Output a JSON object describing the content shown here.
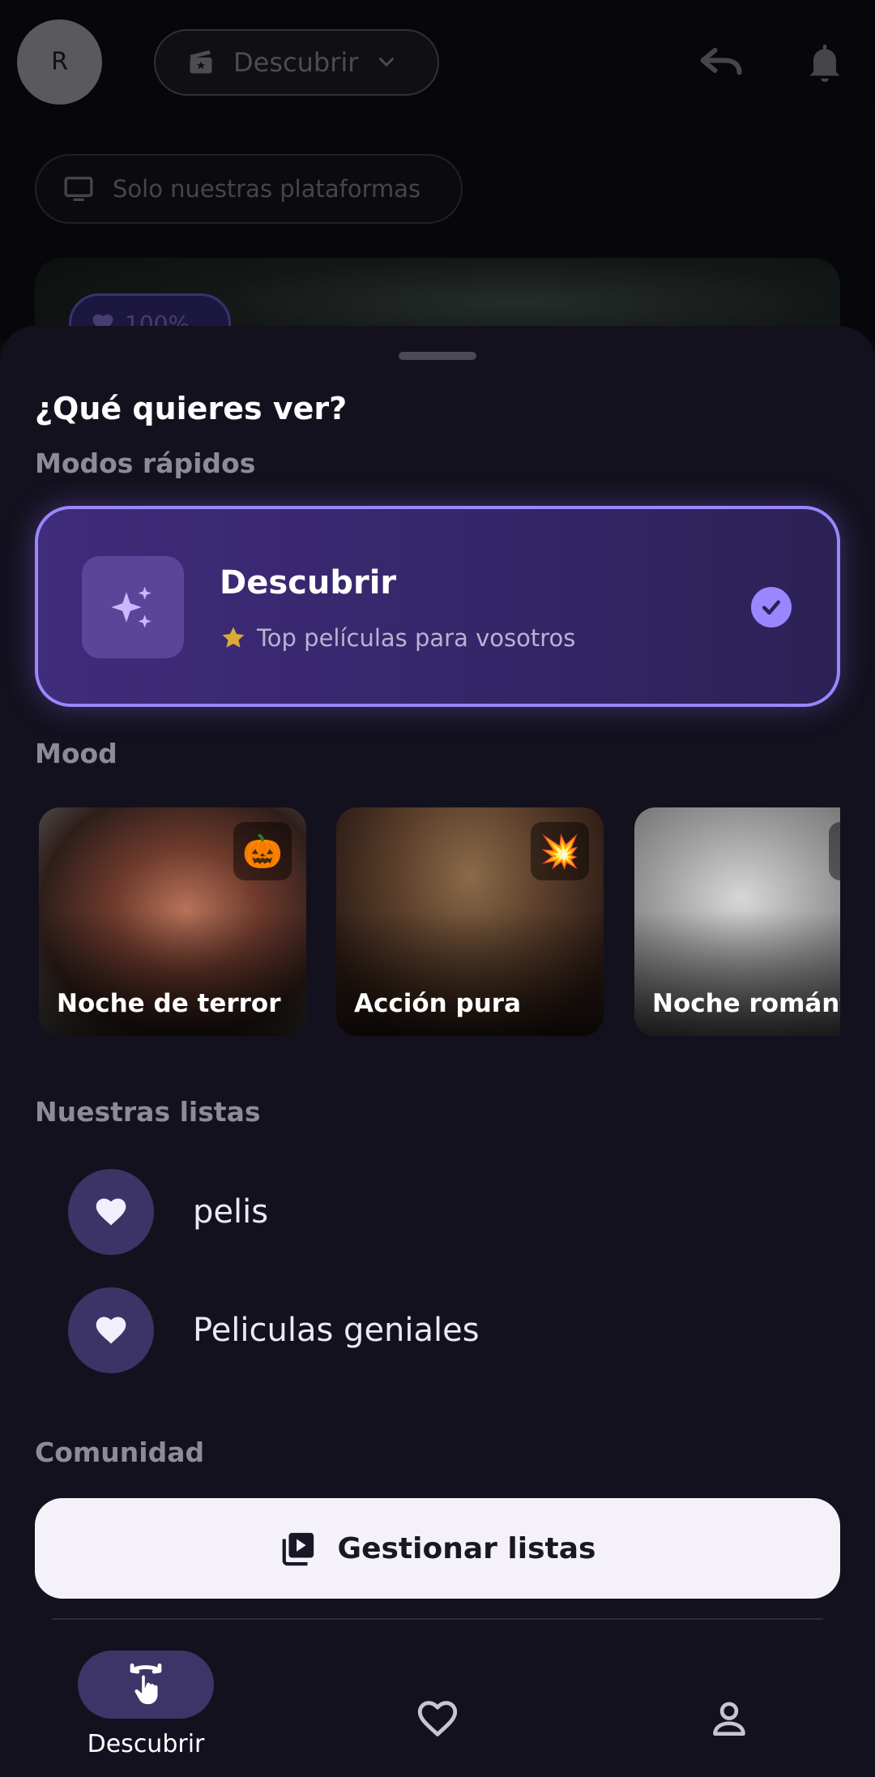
{
  "header": {
    "avatar_initial": "R",
    "mode_selector_label": "Descubrir",
    "platform_filter_label": "Solo nuestras plataformas",
    "poster_match_label": "100%"
  },
  "sheet": {
    "title": "¿Qué quieres ver?",
    "quick_modes_label": "Modos rápidos",
    "quick_mode": {
      "title": "Descubrir",
      "subtitle": "Top películas para vosotros",
      "selected": true
    },
    "mood_label": "Mood",
    "moods": [
      {
        "label": "Noche de terror",
        "emoji": "🎃"
      },
      {
        "label": "Acción pura",
        "emoji": "💥"
      },
      {
        "label": "Noche romántica",
        "emoji": "💗"
      }
    ],
    "lists_label": "Nuestras listas",
    "lists": [
      {
        "name": "pelis"
      },
      {
        "name": "Peliculas geniales"
      }
    ],
    "community_label": "Comunidad",
    "manage_button_label": "Gestionar listas"
  },
  "bottom_nav": {
    "items": [
      {
        "label": "Descubrir",
        "icon": "swipe-icon",
        "active": true
      },
      {
        "label": "",
        "icon": "heart-icon",
        "active": false
      },
      {
        "label": "",
        "icon": "person-icon",
        "active": false
      }
    ]
  },
  "colors": {
    "accent": "#9a86ff",
    "sheet_bg": "#14111e",
    "card_gradient_start": "#3f2c7a",
    "pill_bg": "#3d3468"
  }
}
